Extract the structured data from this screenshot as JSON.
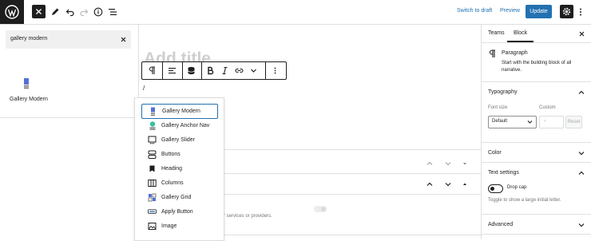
{
  "topbar": {
    "switch_to_draft": "Switch to draft",
    "preview": "Preview",
    "update": "Update"
  },
  "inserter": {
    "search_value": "gallery modern",
    "result_label": "Gallery Modern"
  },
  "editor": {
    "title_placeholder": "Add title",
    "slash_text": "/",
    "background_text": "dule for services or providers."
  },
  "slash_menu": {
    "items": [
      {
        "label": "Gallery Modern",
        "icon": "gallery-modern-icon",
        "active": true
      },
      {
        "label": "Gallery Anchor Nav",
        "icon": "gallery-anchor-nav-icon"
      },
      {
        "label": "Gallery Slider",
        "icon": "gallery-slider-icon"
      },
      {
        "label": "Buttons",
        "icon": "buttons-icon"
      },
      {
        "label": "Heading",
        "icon": "heading-icon"
      },
      {
        "label": "Columns",
        "icon": "columns-icon"
      },
      {
        "label": "Gallery Grid",
        "icon": "gallery-grid-icon"
      },
      {
        "label": "Apply Button",
        "icon": "apply-button-icon"
      },
      {
        "label": "Image",
        "icon": "image-icon"
      }
    ]
  },
  "sidebar": {
    "tab_teams": "Teams",
    "tab_block": "Block",
    "block_name": "Paragraph",
    "block_description_line1": "Start with the building block of all",
    "block_description_line2": "narrative.",
    "typography": "Typography",
    "font_size_label": "Font size",
    "custom_label": "Custom",
    "font_size_value": "Default",
    "reset": "Reset",
    "color": "Color",
    "text_settings": "Text settings",
    "drop_cap": "Drop cap",
    "drop_cap_help": "Toggle to show a large initial letter.",
    "advanced": "Advanced"
  },
  "colors": {
    "accent": "#2271b1",
    "dark": "#1e1e1e"
  }
}
